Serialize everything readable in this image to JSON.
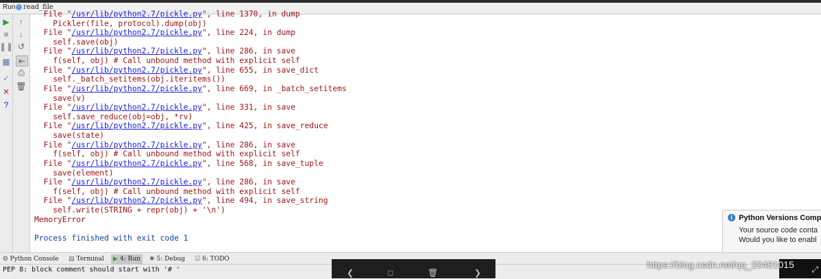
{
  "run_tab": {
    "run_label": "Run",
    "config_name": "read_file"
  },
  "console": {
    "lines": [
      {
        "pre": "  File \"",
        "link": "/usr/lib/python2.7/pickle.py",
        "post": "\", line 1370, in dump"
      },
      {
        "pre": "    Pickler(file, protocol).dump(obj)",
        "link": "",
        "post": ""
      },
      {
        "pre": "  File \"",
        "link": "/usr/lib/python2.7/pickle.py",
        "post": "\", line 224, in dump"
      },
      {
        "pre": "    self.save(obj)",
        "link": "",
        "post": ""
      },
      {
        "pre": "  File \"",
        "link": "/usr/lib/python2.7/pickle.py",
        "post": "\", line 286, in save"
      },
      {
        "pre": "    f(self, obj) # Call unbound method with explicit self",
        "link": "",
        "post": ""
      },
      {
        "pre": "  File \"",
        "link": "/usr/lib/python2.7/pickle.py",
        "post": "\", line 655, in save_dict"
      },
      {
        "pre": "    self._batch_setitems(obj.iteritems())",
        "link": "",
        "post": ""
      },
      {
        "pre": "  File \"",
        "link": "/usr/lib/python2.7/pickle.py",
        "post": "\", line 669, in _batch_setitems"
      },
      {
        "pre": "    save(v)",
        "link": "",
        "post": ""
      },
      {
        "pre": "  File \"",
        "link": "/usr/lib/python2.7/pickle.py",
        "post": "\", line 331, in save"
      },
      {
        "pre": "    self.save_reduce(obj=obj, *rv)",
        "link": "",
        "post": ""
      },
      {
        "pre": "  File \"",
        "link": "/usr/lib/python2.7/pickle.py",
        "post": "\", line 425, in save_reduce"
      },
      {
        "pre": "    save(state)",
        "link": "",
        "post": ""
      },
      {
        "pre": "  File \"",
        "link": "/usr/lib/python2.7/pickle.py",
        "post": "\", line 286, in save"
      },
      {
        "pre": "    f(self, obj) # Call unbound method with explicit self",
        "link": "",
        "post": ""
      },
      {
        "pre": "  File \"",
        "link": "/usr/lib/python2.7/pickle.py",
        "post": "\", line 568, in save_tuple"
      },
      {
        "pre": "    save(element)",
        "link": "",
        "post": ""
      },
      {
        "pre": "  File \"",
        "link": "/usr/lib/python2.7/pickle.py",
        "post": "\", line 286, in save"
      },
      {
        "pre": "    f(self, obj) # Call unbound method with explicit self",
        "link": "",
        "post": ""
      },
      {
        "pre": "  File \"",
        "link": "/usr/lib/python2.7/pickle.py",
        "post": "\", line 494, in save_string"
      },
      {
        "pre": "    self.write(STRING + repr(obj) + '\\n')",
        "link": "",
        "post": ""
      },
      {
        "pre": "MemoryError",
        "link": "",
        "post": ""
      },
      {
        "pre": "",
        "link": "",
        "post": ""
      },
      {
        "pre": "Process finished with exit code 1",
        "link": "",
        "post": "",
        "blue": true
      }
    ]
  },
  "notification": {
    "title": "Python Versions Comp",
    "body1": "Your source code conta",
    "body2": "Would you like to enabl"
  },
  "bottom_tabs": [
    {
      "label": "Python Console",
      "icon": "python-icon",
      "glyph": "❂"
    },
    {
      "label": "Terminal",
      "icon": "terminal-icon",
      "glyph": "▤"
    },
    {
      "label": "4: Run",
      "icon": "run-icon",
      "glyph": "▶",
      "active": true
    },
    {
      "label": "5: Debug",
      "icon": "bug-icon",
      "glyph": "✱"
    },
    {
      "label": "6: TODO",
      "icon": "todo-icon",
      "glyph": "☑"
    }
  ],
  "status_message": "PEP 8: block comment should start with '# '",
  "watermark": "https://blog.csdn.net/qq_20481015",
  "colors": {
    "error_text": "#a31515",
    "link": "#1a1ae6",
    "exit_text": "#0d40a6",
    "run_green": "#2ea043"
  }
}
